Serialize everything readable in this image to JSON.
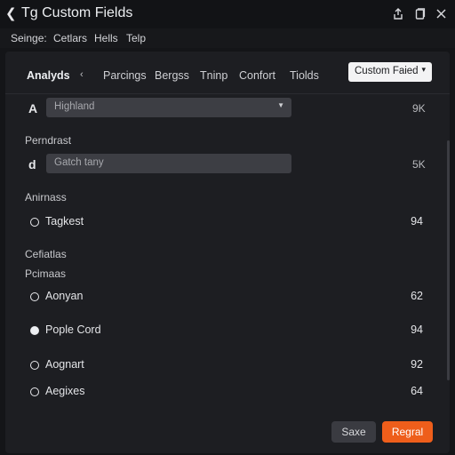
{
  "window": {
    "title": "Tg Custom Fields",
    "back_icon": "chevron-left-icon"
  },
  "menubar": [
    "Seinge:",
    "Cetlars",
    "Hells",
    "Telp"
  ],
  "tabs": {
    "items": [
      "Analyds",
      "Parcings",
      "Bergss",
      "Tninp",
      "Confort",
      "Tiolds"
    ],
    "active": "Analyds",
    "dropdown_label": "Custom Faied"
  },
  "fields": {
    "first": {
      "icon_text": "A",
      "value": "Highland",
      "count": "9K"
    },
    "section_label": "Perndrast",
    "second": {
      "icon_text": "d",
      "value": "Gatch tany",
      "count": "5K"
    }
  },
  "group1": {
    "label": "Anirnass",
    "options": [
      {
        "label": "Tagkest",
        "value": "94",
        "selected": false
      }
    ]
  },
  "group2": {
    "label_a": "Cefiatlas",
    "label_b": "Pcimaas",
    "options": [
      {
        "label": "Aonyan",
        "value": "62",
        "selected": false
      },
      {
        "label": "Pople Cord",
        "value": "94",
        "selected": true
      },
      {
        "label": "Aognart",
        "value": "92",
        "selected": false
      },
      {
        "label": "Aegixes",
        "value": "64",
        "selected": false
      }
    ]
  },
  "footer": {
    "save_label": "Saxe",
    "primary_label": "Regral"
  },
  "colors": {
    "accent": "#ee5e1b",
    "background": "#141518",
    "panel": "#1d1e22"
  }
}
